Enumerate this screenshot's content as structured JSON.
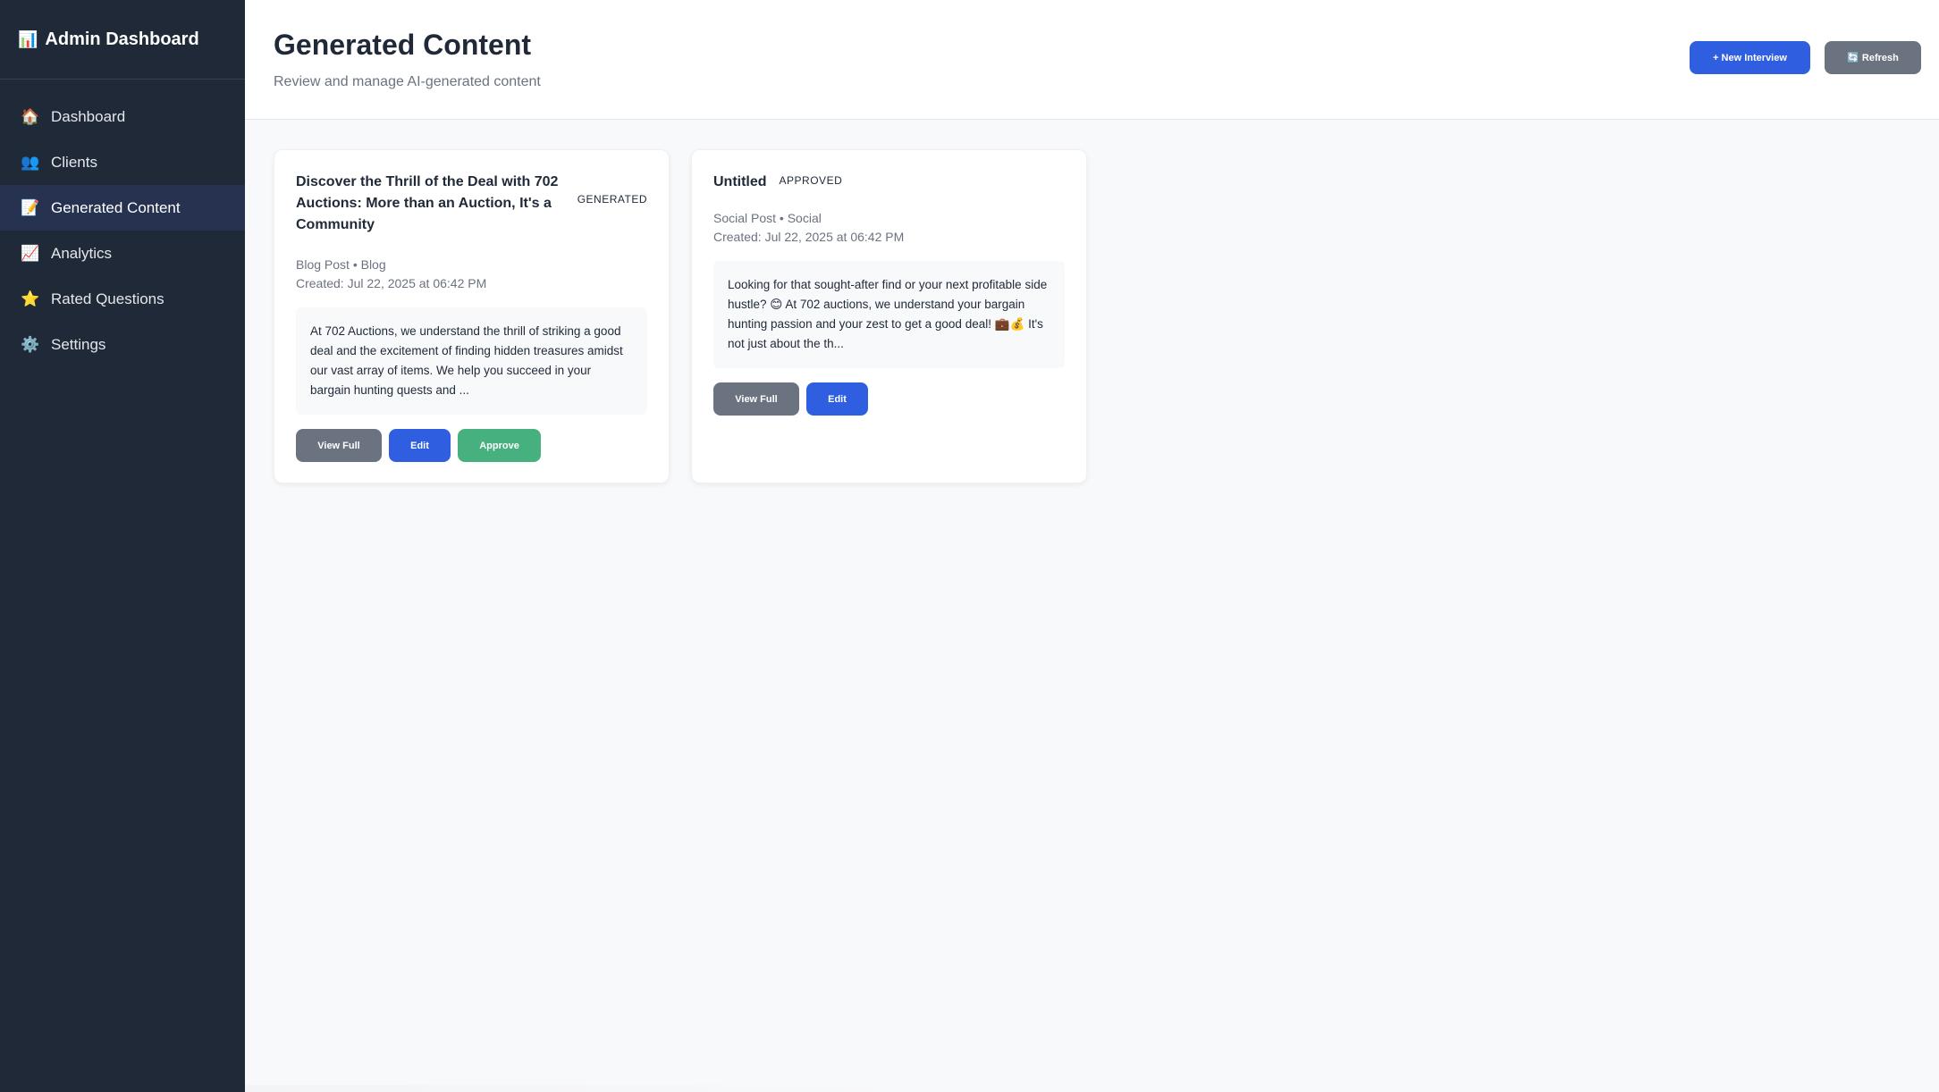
{
  "sidebar": {
    "brand_icon": "📊",
    "brand": "Admin Dashboard",
    "items": [
      {
        "icon": "🏠",
        "label": "Dashboard"
      },
      {
        "icon": "👥",
        "label": "Clients"
      },
      {
        "icon": "📝",
        "label": "Generated Content"
      },
      {
        "icon": "📈",
        "label": "Analytics"
      },
      {
        "icon": "⭐",
        "label": "Rated Questions"
      },
      {
        "icon": "⚙️",
        "label": "Settings"
      }
    ],
    "active_index": 2
  },
  "header": {
    "title": "Generated Content",
    "subtitle": "Review and manage AI-generated content",
    "new_interview_label": "+ New Interview",
    "refresh_label": "🔄 Refresh"
  },
  "cards": [
    {
      "title": "Discover the Thrill of the Deal with 702 Auctions: More than an Auction, It's a Community",
      "status": "GENERATED",
      "type_line": "Blog Post • Blog",
      "created": "Created: Jul 22, 2025 at 06:42 PM",
      "excerpt": "At 702 Auctions, we understand the thrill of striking a good deal and the excitement of finding hidden treasures amidst our vast array of items. We help you succeed in your bargain hunting quests and ...",
      "view_label": "View Full",
      "edit_label": "Edit",
      "approve_label": "Approve"
    },
    {
      "title": "Untitled",
      "status": "APPROVED",
      "type_line": "Social Post • Social",
      "created": "Created: Jul 22, 2025 at 06:42 PM",
      "excerpt": "Looking for that sought-after find or your next profitable side hustle? 😊 At 702 auctions, we understand your bargain hunting passion and your zest to get a good deal! 💼💰 It's not just about the th...",
      "view_label": "View Full",
      "edit_label": "Edit"
    }
  ],
  "colors": {
    "sidebar_bg": "#1f2937",
    "primary": "#2f5fe0",
    "gray_button": "#6b7280",
    "approve_green": "#46b17f"
  }
}
